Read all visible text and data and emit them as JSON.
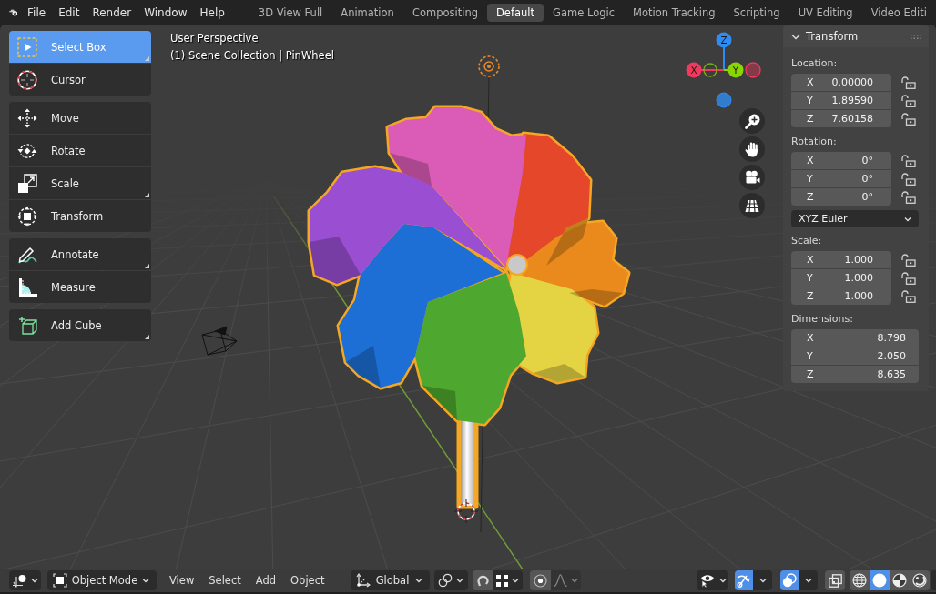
{
  "top_bar": {
    "menus": [
      "File",
      "Edit",
      "Render",
      "Window",
      "Help"
    ],
    "workspace_tabs": [
      {
        "label": "3D View Full",
        "selected": false
      },
      {
        "label": "Animation",
        "selected": false
      },
      {
        "label": "Compositing",
        "selected": false
      },
      {
        "label": "Default",
        "selected": true
      },
      {
        "label": "Game Logic",
        "selected": false
      },
      {
        "label": "Motion Tracking",
        "selected": false
      },
      {
        "label": "Scripting",
        "selected": false
      },
      {
        "label": "UV Editing",
        "selected": false
      },
      {
        "label": "Video Editi",
        "selected": false
      }
    ]
  },
  "toolbar": {
    "groups": [
      {
        "tools": [
          {
            "label": "Select Box",
            "selected": true,
            "more_tools": true
          },
          {
            "label": "Cursor",
            "selected": false,
            "more_tools": false
          }
        ]
      },
      {
        "tools": [
          {
            "label": "Move",
            "selected": false,
            "more_tools": false
          },
          {
            "label": "Rotate",
            "selected": false,
            "more_tools": false
          },
          {
            "label": "Scale",
            "selected": false,
            "more_tools": true
          },
          {
            "label": "Transform",
            "selected": false,
            "more_tools": false
          }
        ]
      },
      {
        "tools": [
          {
            "label": "Annotate",
            "selected": false,
            "more_tools": true
          },
          {
            "label": "Measure",
            "selected": false,
            "more_tools": false
          }
        ]
      },
      {
        "tools": [
          {
            "label": "Add Cube",
            "selected": false,
            "more_tools": true
          }
        ]
      }
    ]
  },
  "viewport": {
    "view_name": "User Perspective",
    "collection_info": "(1) Scene Collection | PinWheel"
  },
  "navigation_gizmo": {
    "axes": [
      {
        "label": "Z",
        "color": "#2f8cf2"
      },
      {
        "label": "X",
        "color": "#f2385c"
      },
      {
        "label": "Y",
        "color": "#8ad600"
      }
    ]
  },
  "transform_panel": {
    "title": "Transform",
    "expanded": true,
    "location": {
      "label": "Location:",
      "fields": [
        {
          "axis": "X",
          "value": "0.00000",
          "locked": false
        },
        {
          "axis": "Y",
          "value": "1.89590",
          "locked": false
        },
        {
          "axis": "Z",
          "value": "7.60158",
          "locked": false
        }
      ]
    },
    "rotation": {
      "label": "Rotation:",
      "fields": [
        {
          "axis": "X",
          "value": "0°",
          "locked": false
        },
        {
          "axis": "Y",
          "value": "0°",
          "locked": false
        },
        {
          "axis": "Z",
          "value": "0°",
          "locked": false
        }
      ],
      "mode": "XYZ Euler"
    },
    "scale": {
      "label": "Scale:",
      "fields": [
        {
          "axis": "X",
          "value": "1.000",
          "locked": false
        },
        {
          "axis": "Y",
          "value": "1.000",
          "locked": false
        },
        {
          "axis": "Z",
          "value": "1.000",
          "locked": false
        }
      ]
    },
    "dimensions": {
      "label": "Dimensions:",
      "fields": [
        {
          "axis": "X",
          "value": "8.798"
        },
        {
          "axis": "Y",
          "value": "2.050"
        },
        {
          "axis": "Z",
          "value": "8.635"
        }
      ]
    }
  },
  "header": {
    "mode": "Object Mode",
    "menus": [
      "View",
      "Select",
      "Add",
      "Object"
    ],
    "orientation": "Global",
    "snap": {
      "on": false
    },
    "proportional_editing": {
      "on": false
    },
    "falloff": {
      "disabled": true
    },
    "gizmos": {
      "on": true
    },
    "overlays": {
      "on": true
    },
    "xray": {
      "on": false
    },
    "shading_modes": [
      {
        "selected": false
      },
      {
        "selected": true
      },
      {
        "selected": false
      },
      {
        "selected": false
      }
    ]
  }
}
